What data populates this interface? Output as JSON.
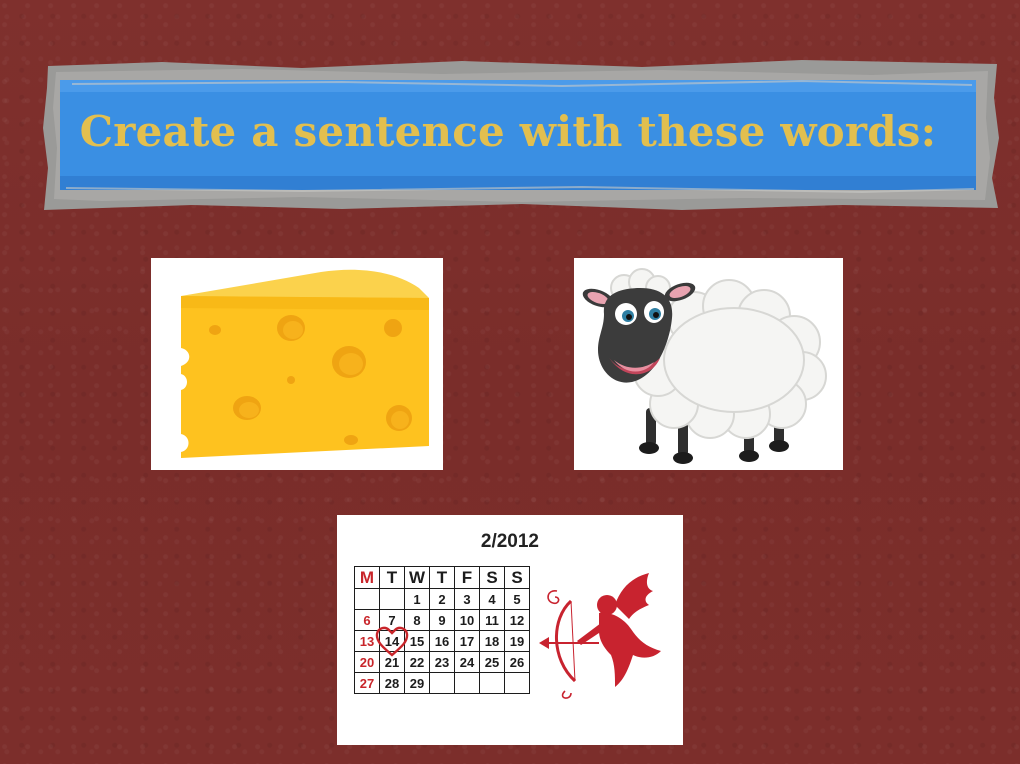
{
  "slide": {
    "title": "Create a sentence with these words:",
    "background_color": "#7e2f2c",
    "title_color": "#e2bf4f",
    "banner_color": "#3a8fe3"
  },
  "pictures": [
    {
      "name": "cheese",
      "description_icon": "cheese-wedge-icon"
    },
    {
      "name": "sheep",
      "description_icon": "sheep-icon"
    },
    {
      "name": "calendar",
      "description_icon": "valentine-calendar-icon"
    }
  ],
  "calendar": {
    "title": "2/2012",
    "weekdays": [
      "M",
      "T",
      "W",
      "T",
      "F",
      "S",
      "S"
    ],
    "weeks": [
      [
        "",
        "",
        "1",
        "2",
        "3",
        "4",
        "5"
      ],
      [
        "6",
        "7",
        "8",
        "9",
        "10",
        "11",
        "12"
      ],
      [
        "13",
        "14",
        "15",
        "16",
        "17",
        "18",
        "19"
      ],
      [
        "20",
        "21",
        "22",
        "23",
        "24",
        "25",
        "26"
      ],
      [
        "27",
        "28",
        "29",
        "",
        "",
        "",
        ""
      ]
    ],
    "highlight_day": "14",
    "accent_color": "#c8252a"
  }
}
